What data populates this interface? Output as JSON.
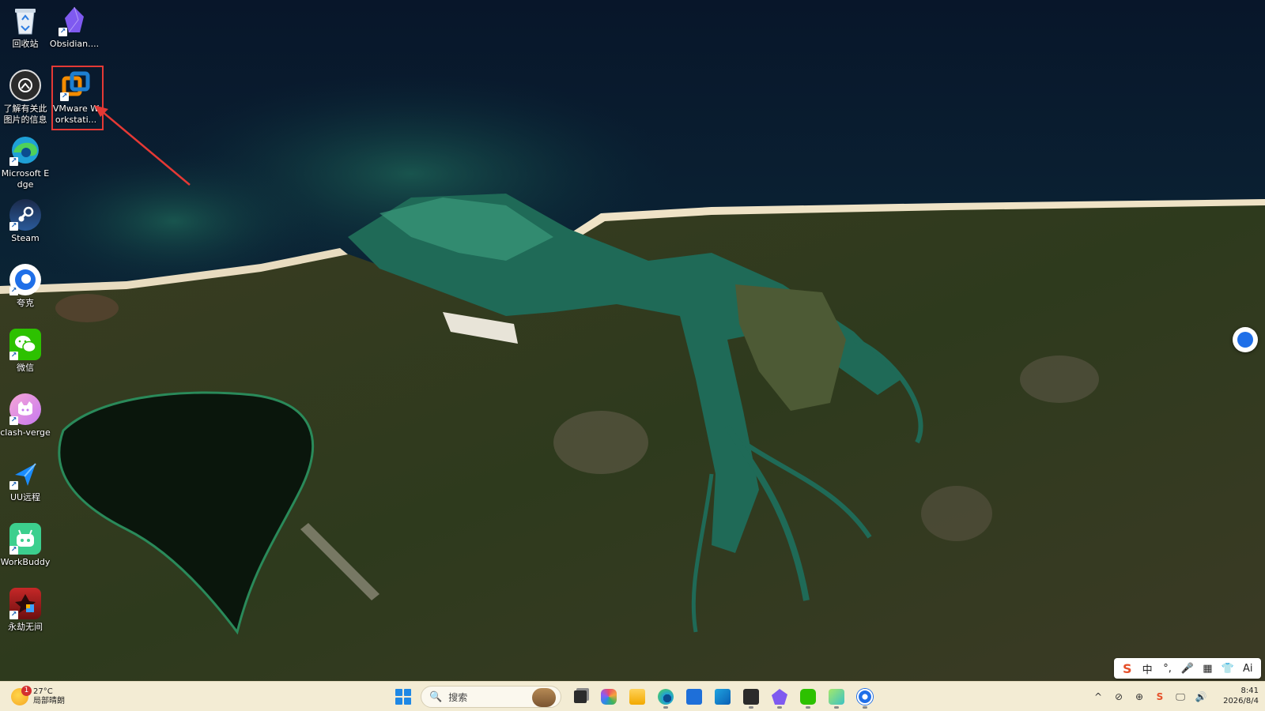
{
  "desktop": {
    "icons": [
      {
        "id": "recycle-bin",
        "label": "回收站",
        "icon": "recycle-bin-icon"
      },
      {
        "id": "obsidian",
        "label": "Obsidian....",
        "icon": "obsidian-icon"
      },
      {
        "id": "learn-picture",
        "label": "了解有关此图片的信息",
        "icon": "camera-info-icon"
      },
      {
        "id": "vmware",
        "label": "VMware Workstati...",
        "icon": "vmware-icon"
      },
      {
        "id": "edge",
        "label": "Microsoft Edge",
        "icon": "edge-icon"
      },
      {
        "id": "steam",
        "label": "Steam",
        "icon": "steam-icon"
      },
      {
        "id": "kuake",
        "label": "夸克",
        "icon": "quark-icon"
      },
      {
        "id": "wechat",
        "label": "微信",
        "icon": "wechat-icon"
      },
      {
        "id": "clash",
        "label": "clash-verge",
        "icon": "clash-verge-icon"
      },
      {
        "id": "uu",
        "label": "UU远程",
        "icon": "uu-remote-icon"
      },
      {
        "id": "workbuddy",
        "label": "WorkBuddy",
        "icon": "workbuddy-icon"
      },
      {
        "id": "naraka",
        "label": "永劫无间",
        "icon": "naraka-icon"
      }
    ],
    "highlight_color": "#e53935"
  },
  "ime": {
    "items": [
      "S",
      "中",
      "°,",
      "🎤",
      "▦",
      "👕",
      "Ai"
    ]
  },
  "taskbar": {
    "weather": {
      "temp": "27°C",
      "desc": "局部晴朗",
      "badge": "1"
    },
    "search_placeholder": "搜索",
    "apps": [
      "file-explorer",
      "microsoft-365",
      "folder",
      "edge",
      "store",
      "outlook",
      "terminal",
      "obsidian",
      "wechat",
      "clash",
      "quark"
    ],
    "tray": [
      "^",
      "⊘",
      "⊕",
      "S",
      "🖵",
      "🔊"
    ],
    "clock": {
      "time": "8:41",
      "date": "2026/8/4"
    }
  }
}
